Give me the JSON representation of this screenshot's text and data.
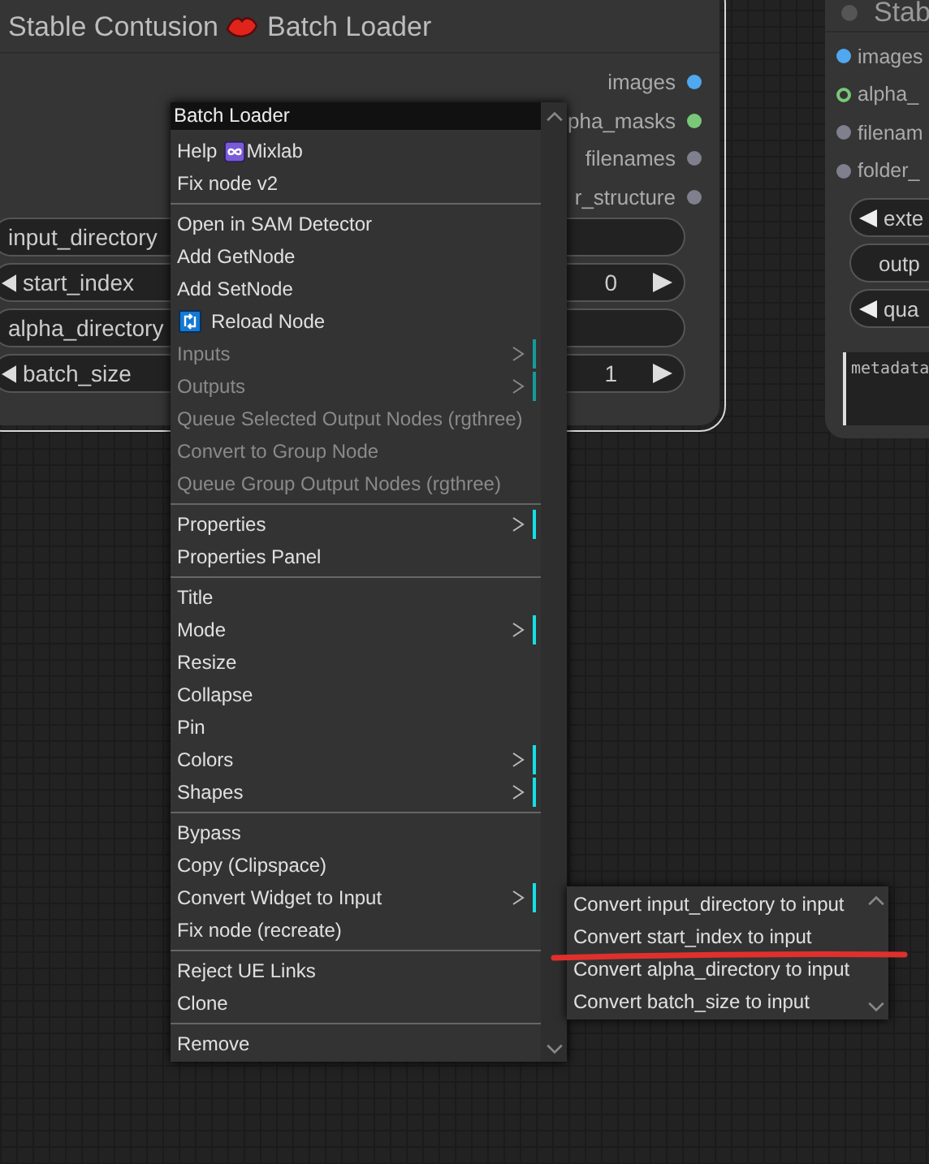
{
  "node": {
    "title_prefix": "Stable Contusion",
    "title_suffix": "Batch Loader",
    "outputs": [
      {
        "label": "images",
        "color": "#4fa8f0"
      },
      {
        "label": "pha_masks",
        "color": "#78c878"
      },
      {
        "label": "filenames",
        "color": "#7f7f8e"
      },
      {
        "label": "r_structure",
        "color": "#7f7f8e"
      }
    ],
    "widgets": [
      {
        "kind": "text",
        "label": "input_directory"
      },
      {
        "kind": "number",
        "label": "start_index",
        "value": "0"
      },
      {
        "kind": "text",
        "label": "alpha_directory"
      },
      {
        "kind": "number",
        "label": "batch_size",
        "value": "1"
      }
    ]
  },
  "node_right": {
    "title": "Stab",
    "outputs": [
      {
        "label": "images",
        "color": "#4fa8f0",
        "hollow": false
      },
      {
        "label": "alpha_",
        "color": "#78c878",
        "hollow": true
      },
      {
        "label": "filenam",
        "color": "#7f7f8e",
        "hollow": false
      },
      {
        "label": "folder_",
        "color": "#7f7f8e",
        "hollow": false
      }
    ],
    "widgets": [
      {
        "kind": "combo",
        "label": "exte"
      },
      {
        "kind": "text",
        "label": "outp"
      },
      {
        "kind": "combo",
        "label": "qua"
      }
    ],
    "textarea": {
      "value": "metadata"
    }
  },
  "context_menu": {
    "title": "Batch Loader",
    "items": [
      {
        "kind": "badge_item",
        "label": "Help",
        "badge_label": "Mixlab",
        "disabled": false,
        "submenu": false
      },
      {
        "kind": "item",
        "label": "Fix node v2",
        "disabled": false,
        "submenu": false
      },
      {
        "kind": "separator"
      },
      {
        "kind": "item",
        "label": "Open in SAM Detector",
        "disabled": false,
        "submenu": false
      },
      {
        "kind": "item",
        "label": "Add GetNode",
        "disabled": false,
        "submenu": false
      },
      {
        "kind": "item",
        "label": "Add SetNode",
        "disabled": false,
        "submenu": false
      },
      {
        "kind": "icon_item",
        "label": "Reload Node",
        "disabled": false,
        "submenu": false
      },
      {
        "kind": "item",
        "label": "Inputs",
        "disabled": true,
        "submenu": true
      },
      {
        "kind": "item",
        "label": "Outputs",
        "disabled": true,
        "submenu": true
      },
      {
        "kind": "item",
        "label": "Queue Selected Output Nodes (rgthree)",
        "disabled": true,
        "submenu": false
      },
      {
        "kind": "item",
        "label": "Convert to Group Node",
        "disabled": true,
        "submenu": false
      },
      {
        "kind": "item",
        "label": "Queue Group Output Nodes (rgthree)",
        "disabled": true,
        "submenu": false
      },
      {
        "kind": "separator"
      },
      {
        "kind": "item",
        "label": "Properties",
        "disabled": false,
        "submenu": true
      },
      {
        "kind": "item",
        "label": "Properties Panel",
        "disabled": false,
        "submenu": false
      },
      {
        "kind": "separator"
      },
      {
        "kind": "item",
        "label": "Title",
        "disabled": false,
        "submenu": false
      },
      {
        "kind": "item",
        "label": "Mode",
        "disabled": false,
        "submenu": true
      },
      {
        "kind": "item",
        "label": "Resize",
        "disabled": false,
        "submenu": false
      },
      {
        "kind": "item",
        "label": "Collapse",
        "disabled": false,
        "submenu": false
      },
      {
        "kind": "item",
        "label": "Pin",
        "disabled": false,
        "submenu": false
      },
      {
        "kind": "item",
        "label": "Colors",
        "disabled": false,
        "submenu": true
      },
      {
        "kind": "item",
        "label": "Shapes",
        "disabled": false,
        "submenu": true
      },
      {
        "kind": "separator"
      },
      {
        "kind": "item",
        "label": "Bypass",
        "disabled": false,
        "submenu": false
      },
      {
        "kind": "item",
        "label": "Copy (Clipspace)",
        "disabled": false,
        "submenu": false
      },
      {
        "kind": "item",
        "label": "Convert Widget to Input",
        "disabled": false,
        "submenu": true
      },
      {
        "kind": "item",
        "label": "Fix node (recreate)",
        "disabled": false,
        "submenu": false
      },
      {
        "kind": "separator"
      },
      {
        "kind": "item",
        "label": "Reject UE Links",
        "disabled": false,
        "submenu": false
      },
      {
        "kind": "item",
        "label": "Clone",
        "disabled": false,
        "submenu": false
      },
      {
        "kind": "separator"
      },
      {
        "kind": "item",
        "label": "Remove",
        "disabled": false,
        "submenu": false
      }
    ]
  },
  "submenu": {
    "items": [
      {
        "label": "Convert input_directory to input"
      },
      {
        "label": "Convert start_index to input"
      },
      {
        "label": "Convert alpha_directory to input"
      },
      {
        "label": "Convert batch_size to input"
      }
    ]
  }
}
